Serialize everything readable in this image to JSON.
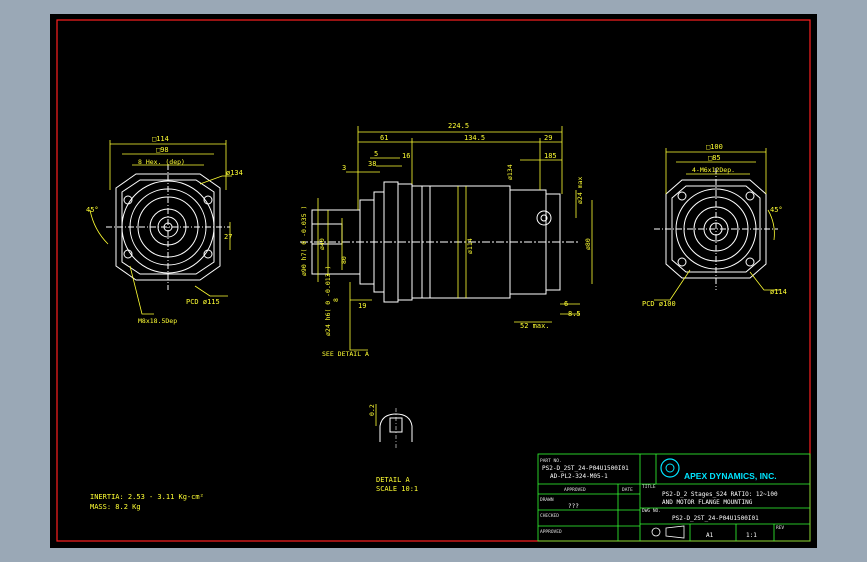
{
  "colors": {
    "background": "#000000",
    "window": "#9aa8b6",
    "border": "#ff2020",
    "geometry": "#ffffff",
    "dimensions": "#ffff33",
    "titleblock_lines": "#33ff33",
    "logo": "#00e5ff"
  },
  "left_view": {
    "flange_square": "□114",
    "inner_square": "□98",
    "bolt_holes": "8 Hex. (dep)",
    "diameter_134": "ø134",
    "angle": "45°",
    "dim_27": "27",
    "pcd": "PCD ø115",
    "thread": "M8x18.5Dep"
  },
  "side_view": {
    "overall_length": "224.5",
    "dim_61": "61",
    "dim_134_5": "134.5",
    "dim_29": "29",
    "dim_5": "5",
    "dim_16": "16",
    "dim_3": "3",
    "dim_38": "38",
    "dim_185": "185",
    "dia_134": "ø134",
    "dia_114": "ø114",
    "dia_90": "ø90 h7( 0 -0.035 )",
    "dia_40": "ø40",
    "dim_80": "80",
    "dia_24": "ø24 max",
    "dia_80": "ø80",
    "key": "ø24 h6( 0 -0.013 )",
    "dim_8": "8",
    "dim_19": "19",
    "dim_6": "6",
    "dim_8_5": "8.5",
    "max_52": "52 max.",
    "see_detail": "SEE DETAIL A"
  },
  "right_view": {
    "square_100": "□100",
    "square_85": "□85",
    "holes": "4-M6x12Dep.",
    "angle": "45°",
    "pcd": "PCD ø100",
    "dia_114": "ø114"
  },
  "detail": {
    "dim_top": "0.2",
    "label": "DETAIL A",
    "scale": "SCALE 10:1"
  },
  "notes": {
    "inertia": "INERTIA: 2.53 - 3.11 Kg-cm²",
    "mass": "MASS: 8.2 Kg"
  },
  "title_block": {
    "part_no_label": "PART NO.",
    "part_no_1": "PS2-D_2ST_24-P04U1500I01",
    "part_no_2": "AD-PL2-324-M05-1",
    "company": "APEX DYNAMICS, INC.",
    "title_label": "TITLE",
    "title_1": "PS2-D_2 Stages_S24   RATIO: 12~100",
    "title_2": "AND MOTOR FLANGE MOUNTING",
    "approved": "APPROVED",
    "date": "DATE",
    "drawn_label": "DRAWN",
    "drawn_value": "???",
    "checked": "CHECKED",
    "approval": "APPROVED",
    "dwg_no_label": "DWG NO.",
    "dwg_no": "PS2-D_2ST_24-P04U1500I01",
    "size": "A1",
    "scale": "1:1",
    "rev_label": "REV"
  }
}
